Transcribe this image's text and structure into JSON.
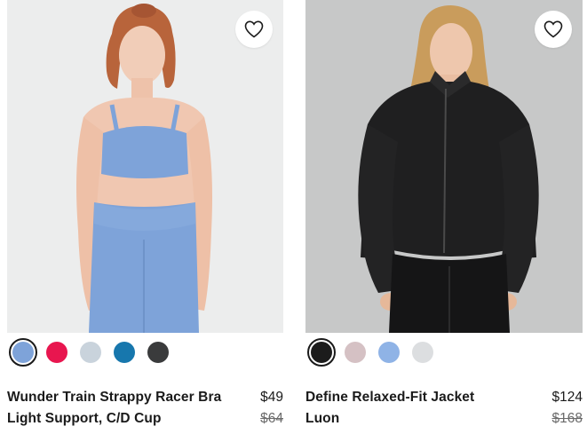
{
  "products": [
    {
      "name_line1": "Wunder Train Strappy Racer Bra",
      "name_line2": "Light Support, C/D Cup",
      "price": "$49",
      "original_price": "$64",
      "swatch_colors": [
        "#7ea3d9",
        "#e8164f",
        "#c9d3dc",
        "#1777ad",
        "#3a3b3c"
      ],
      "selected_swatch": 0
    },
    {
      "name_line1": "Define Relaxed-Fit Jacket",
      "name_line2": "Luon",
      "price": "$124",
      "original_price": "$168",
      "swatch_colors": [
        "#1c1c1c",
        "#d5c1c4",
        "#8fb3e6",
        "#dcdee0"
      ],
      "selected_swatch": 0
    }
  ],
  "icons": {
    "favorite": "heart-outline-icon"
  }
}
